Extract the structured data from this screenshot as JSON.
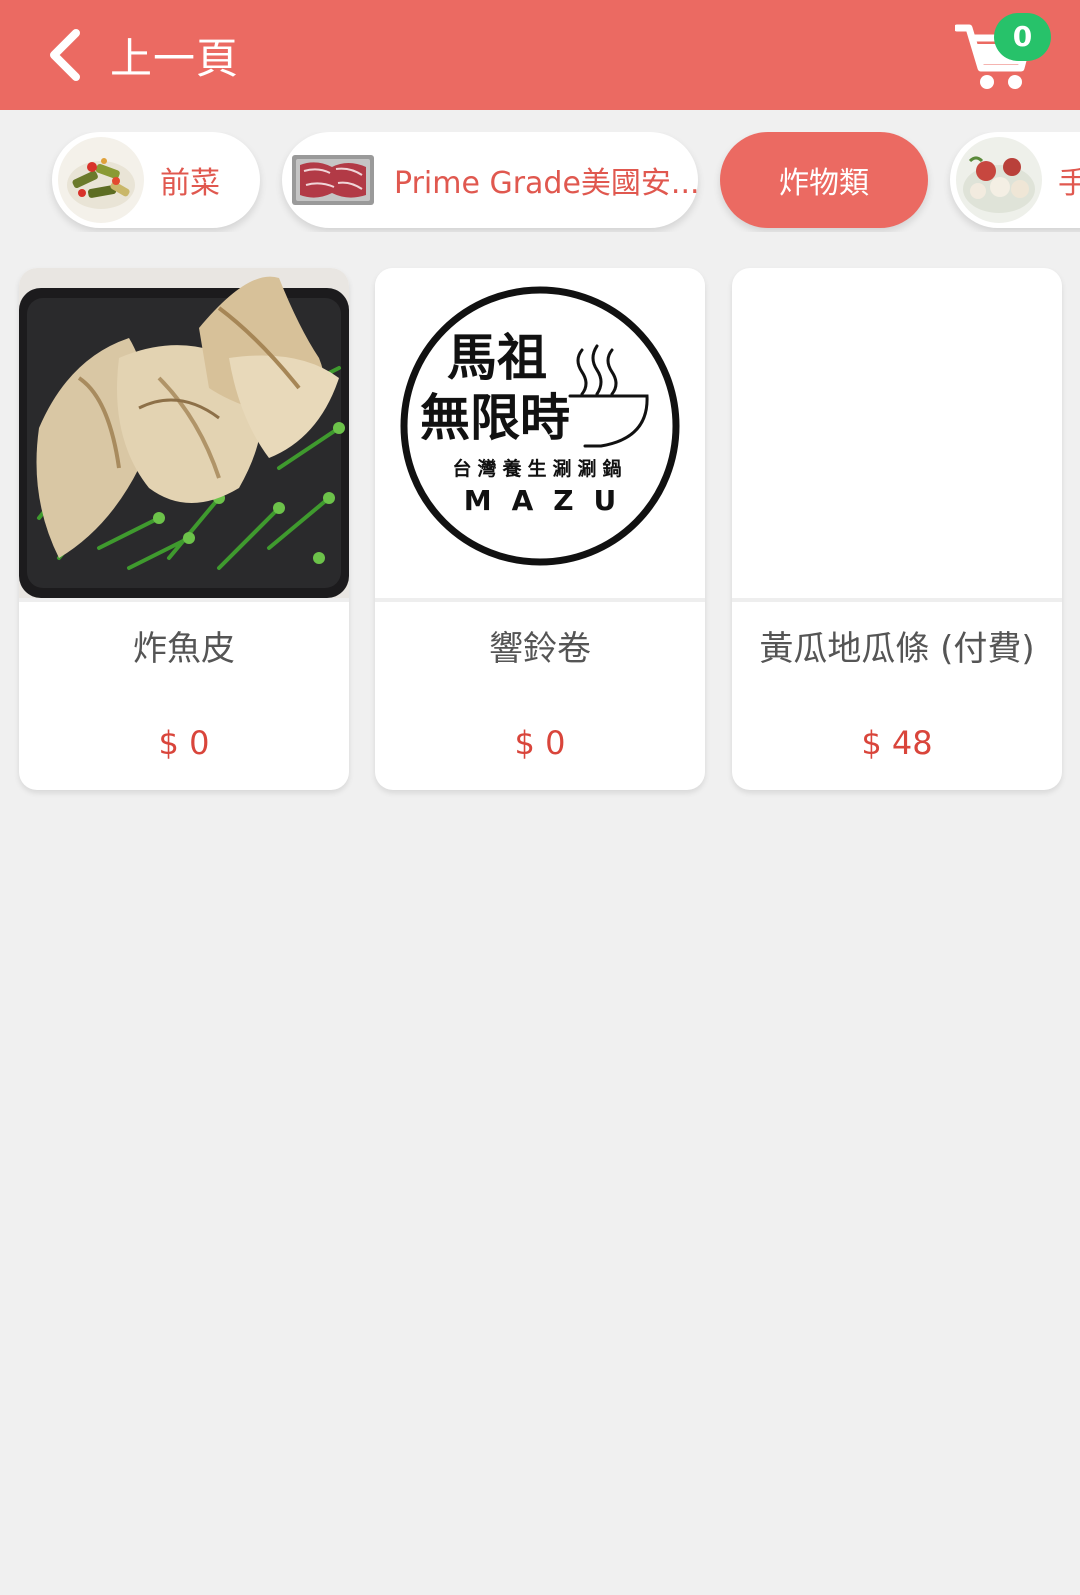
{
  "header": {
    "back_label": "上一頁",
    "cart_count": "0"
  },
  "categories": [
    {
      "label": "前菜",
      "active": false
    },
    {
      "label": "Prime Grade美國安...",
      "active": false
    },
    {
      "label": "炸物類",
      "active": true
    },
    {
      "label": "手",
      "active": false
    }
  ],
  "products": [
    {
      "name": "炸魚皮",
      "price": "$ 0",
      "image": "fried-fish-skin"
    },
    {
      "name": "響鈴卷",
      "price": "$ 0",
      "image": "mazu-logo"
    },
    {
      "name": "黃瓜地瓜條 (付費)",
      "price": "$ 48",
      "image": ""
    }
  ],
  "logo": {
    "line1": "馬祖",
    "line2": "無限時",
    "line3": "台灣養生涮涮鍋",
    "line4": "MAZU"
  },
  "colors": {
    "accent": "#eb6a62",
    "badge": "#27c26a",
    "price": "#d9453b"
  }
}
